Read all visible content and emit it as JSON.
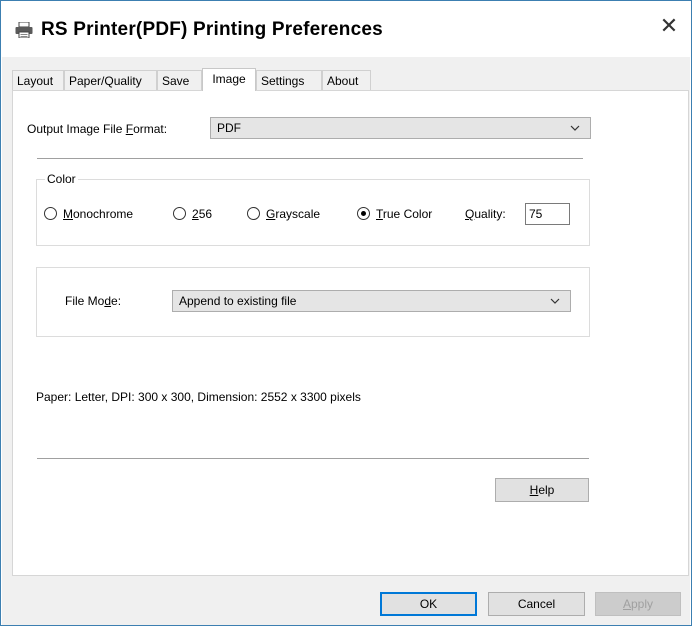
{
  "window": {
    "title": "RS Printer(PDF) Printing Preferences",
    "close_glyph": "✕",
    "title_icon": "printer-icon"
  },
  "tabs": [
    {
      "label": "Layout"
    },
    {
      "label": "Paper/Quality"
    },
    {
      "label": "Save"
    },
    {
      "label": "Image",
      "active": true
    },
    {
      "label": "Settings"
    },
    {
      "label": "About"
    }
  ],
  "image_tab": {
    "format": {
      "label_pre": "Output Image File ",
      "label_key": "F",
      "label_post": "ormat:",
      "value": "PDF"
    },
    "color_group": {
      "title": "Color",
      "options": [
        {
          "key": "M",
          "rest": "onochrome",
          "checked": false
        },
        {
          "key": "2",
          "rest": "56",
          "checked": false
        },
        {
          "key": "G",
          "rest": "rayscale",
          "checked": false
        },
        {
          "key": "T",
          "rest": "rue Color",
          "checked": true
        }
      ],
      "quality_key": "Q",
      "quality_rest": "uality:",
      "quality_value": "75"
    },
    "file_mode": {
      "label_pre": "File Mo",
      "label_key": "d",
      "label_post": "e:",
      "value": "Append to existing file"
    },
    "info_text": "Paper: Letter, DPI: 300 x 300, Dimension: 2552 x 3300 pixels",
    "help_key": "H",
    "help_rest": "elp"
  },
  "footer": {
    "ok_label": "OK",
    "cancel_label": "Cancel",
    "apply_key": "A",
    "apply_rest": "pply"
  },
  "colors": {
    "accent": "#0078d7",
    "window_border": "#3c7fb1",
    "dialog_bg": "#f0f0f0"
  }
}
